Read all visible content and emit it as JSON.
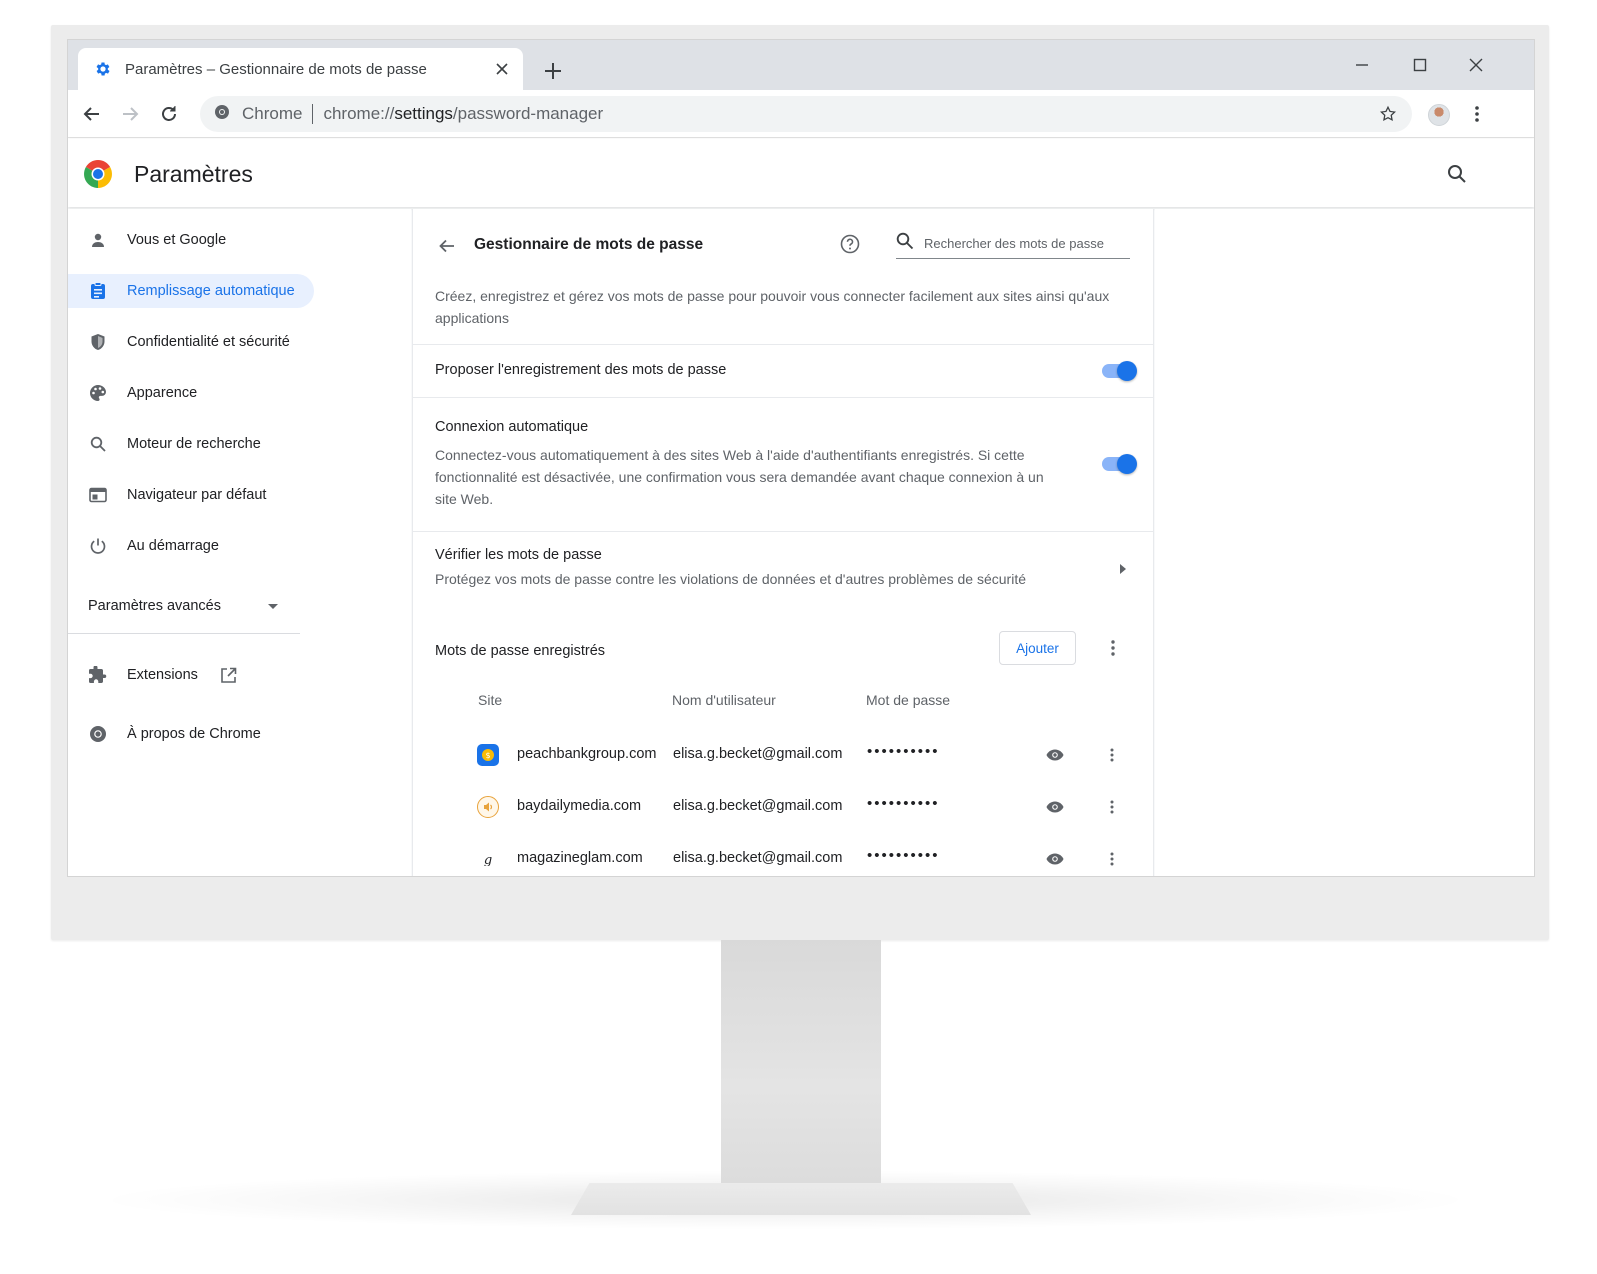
{
  "browser": {
    "tab_title": "Paramètres – Gestionnaire de mots de passe",
    "omnibox": {
      "site_label": "Chrome",
      "url_prefix": "chrome://",
      "url_host": "settings",
      "url_path": "/password-manager"
    }
  },
  "settings": {
    "title": "Paramètres",
    "sidebar": {
      "items": [
        {
          "label": "Vous et Google",
          "icon": "person-icon"
        },
        {
          "label": "Remplissage automatique",
          "icon": "assignment-icon",
          "active": true
        },
        {
          "label": "Confidentialité et sécurité",
          "icon": "shield-icon"
        },
        {
          "label": "Apparence",
          "icon": "palette-icon"
        },
        {
          "label": "Moteur de recherche",
          "icon": "search-icon"
        },
        {
          "label": "Navigateur par défaut",
          "icon": "browser-icon"
        },
        {
          "label": "Au démarrage",
          "icon": "power-icon"
        }
      ],
      "advanced_label": "Paramètres avancés",
      "extensions_label": "Extensions",
      "about_label": "À propos de Chrome"
    },
    "password_manager": {
      "title": "Gestionnaire de mots de passe",
      "search_placeholder": "Rechercher des mots de passe",
      "description": "Créez, enregistrez et gérez vos mots de passe pour pouvoir vous connecter facilement aux sites ainsi qu'aux applications",
      "offer_save": {
        "label": "Proposer l'enregistrement des mots de passe",
        "enabled": true
      },
      "auto_signin": {
        "label": "Connexion automatique",
        "description": "Connectez-vous automatiquement à des sites Web à l'aide d'authentifiants enregistrés. Si cette fonctionnalité est désactivée, une confirmation vous sera demandée avant chaque connexion à un site Web.",
        "enabled": true
      },
      "check": {
        "label": "Vérifier les mots de passe",
        "description": "Protégez vos mots de passe contre les violations de données et d'autres problèmes de sécurité"
      },
      "saved": {
        "title": "Mots de passe enregistrés",
        "add_label": "Ajouter",
        "columns": {
          "site": "Site",
          "username": "Nom d'utilisateur",
          "password": "Mot de passe"
        },
        "rows": [
          {
            "site": "peachbankgroup.com",
            "username": "elisa.g.becket@gmail.com",
            "password": "••••••••••",
            "icon": "peachbank-icon",
            "icon_color": "#1a73e8"
          },
          {
            "site": "baydailymedia.com",
            "username": "elisa.g.becket@gmail.com",
            "password": "••••••••••",
            "icon": "baydaily-icon",
            "icon_color": "#e8a33c"
          },
          {
            "site": "magazineglam.com",
            "username": "elisa.g.becket@gmail.com",
            "password": "••••••••••",
            "icon": "magazineglam-icon",
            "icon_color": "#202124"
          }
        ]
      }
    }
  },
  "colors": {
    "accent": "#1a73e8",
    "toggle_track": "#8ab4f8",
    "tabstrip": "#dee1e6"
  }
}
